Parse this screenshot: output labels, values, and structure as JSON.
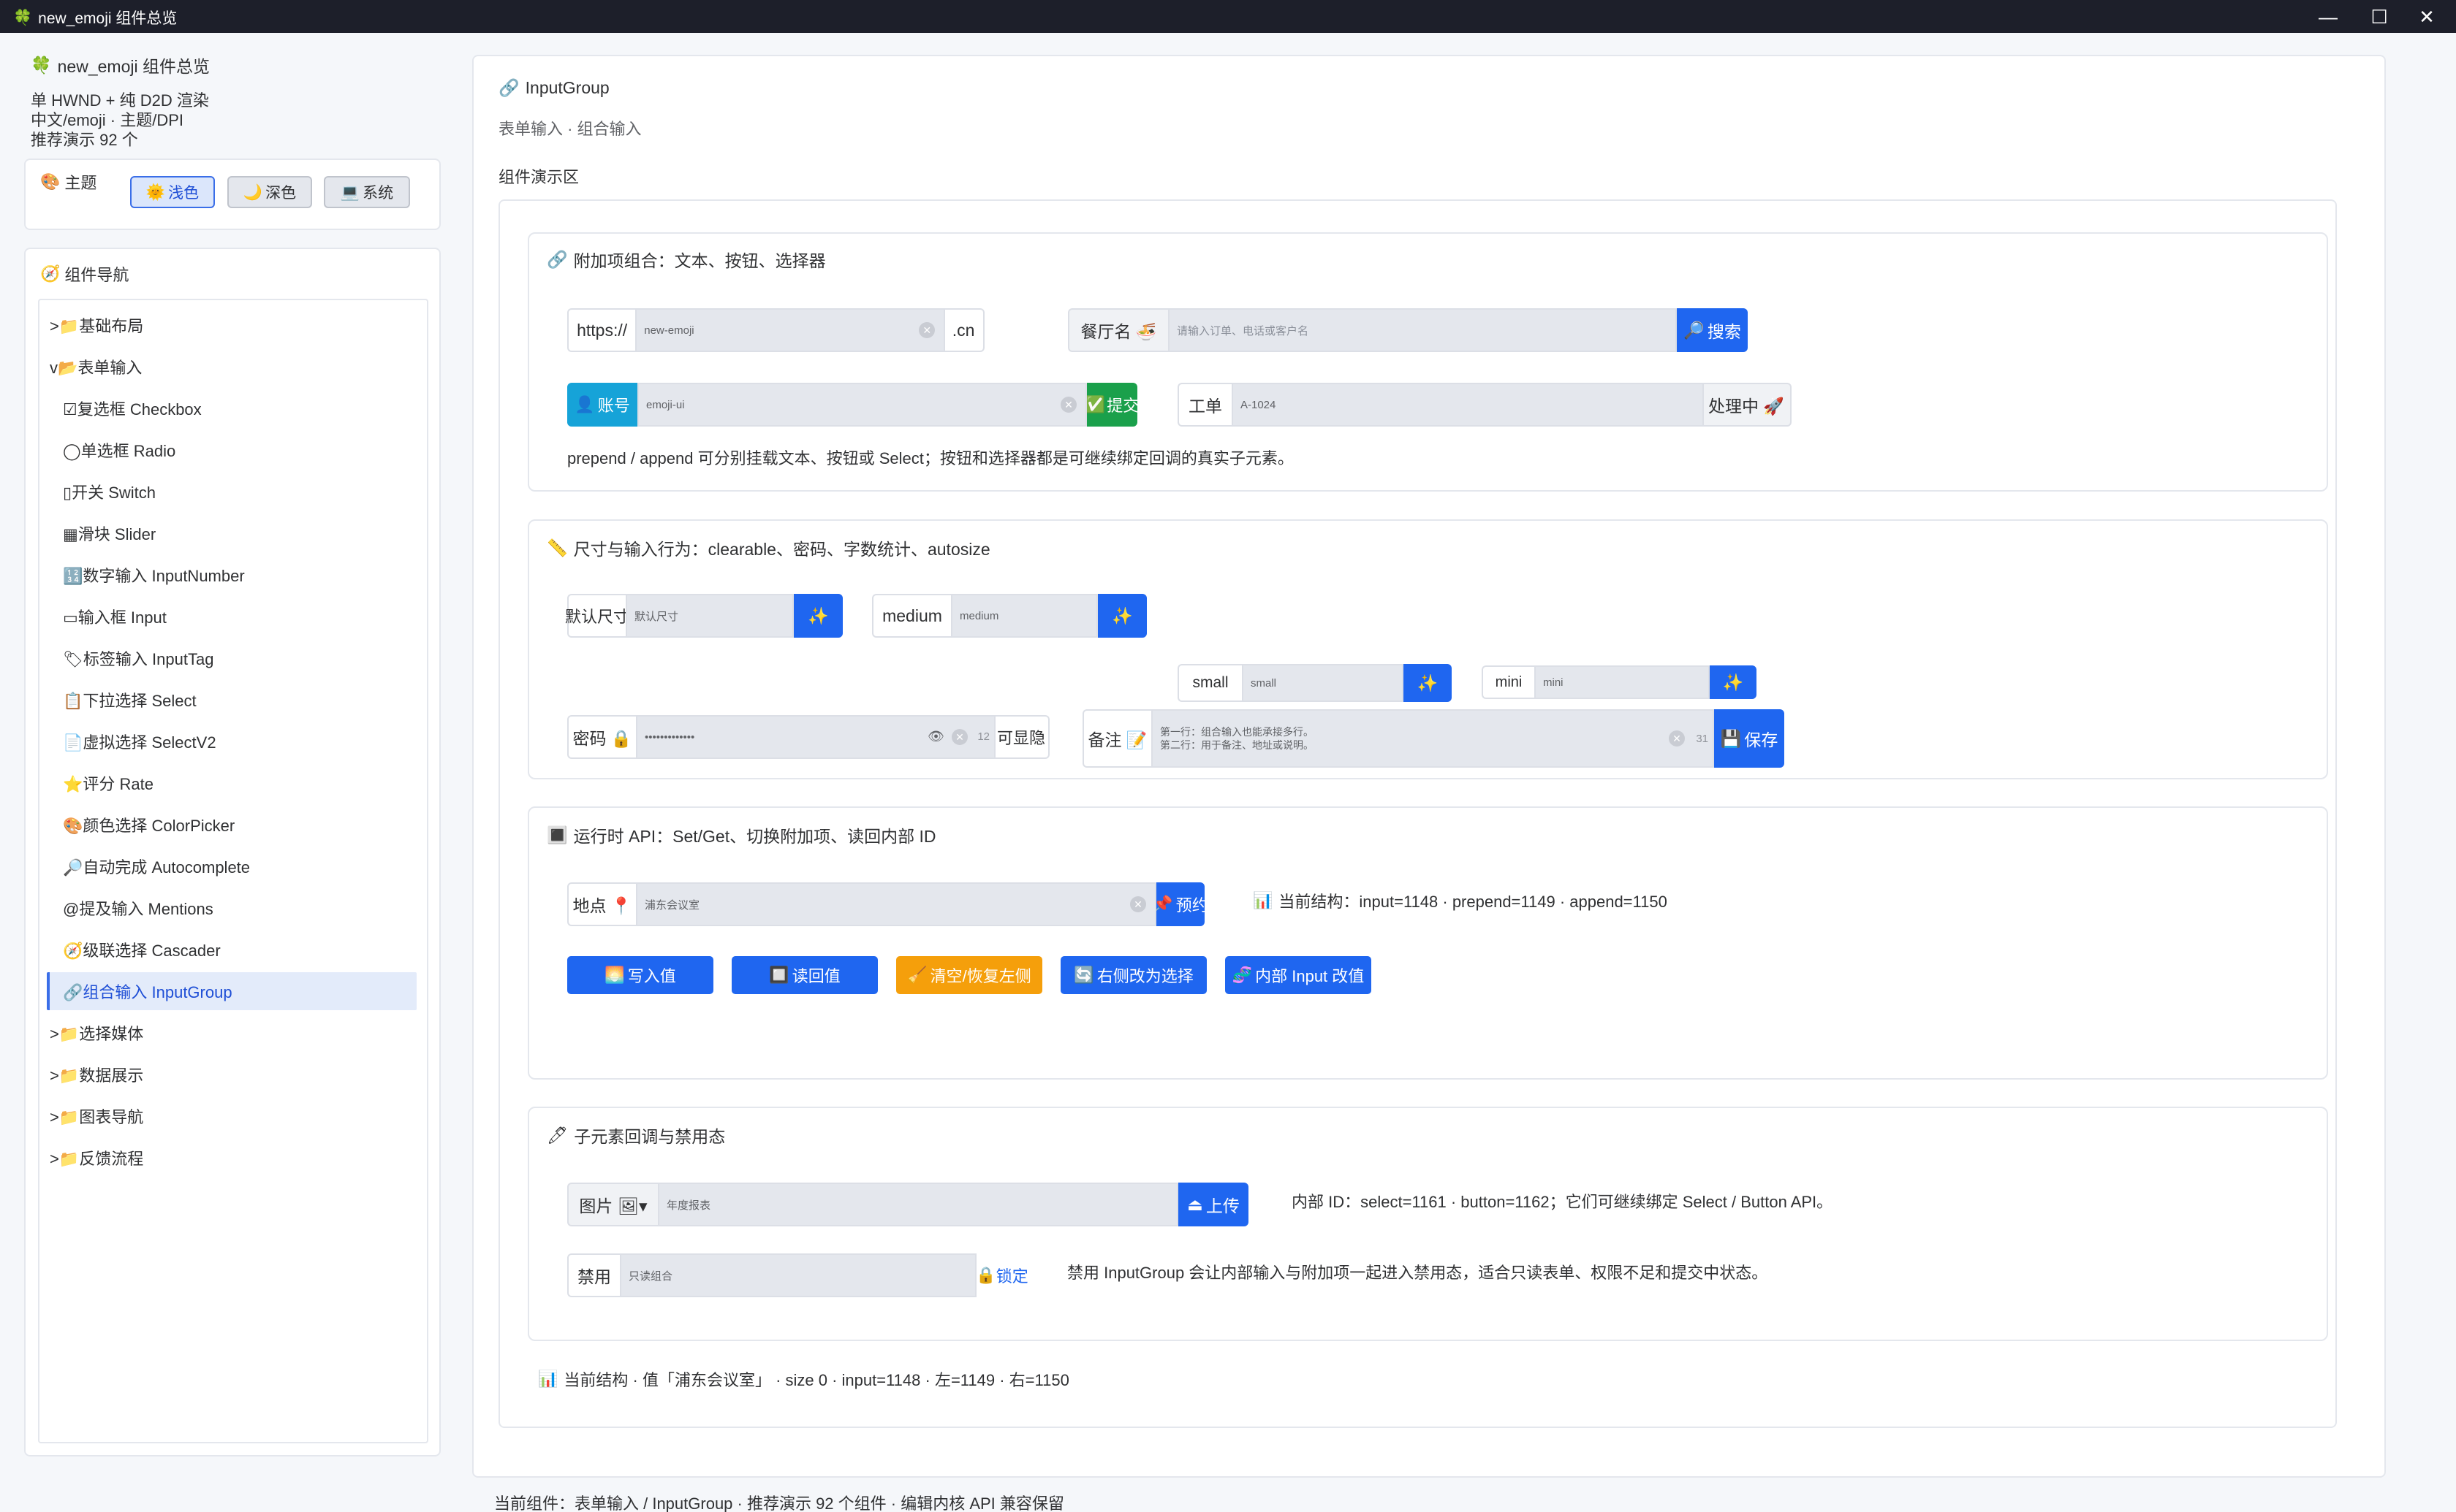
{
  "window": {
    "title": "new_emoji 组件总览",
    "minimize": "—",
    "maximize": "☐",
    "close": "✕"
  },
  "sidebar": {
    "app_title": "new_emoji 组件总览",
    "desc": [
      "单 HWND + 纯 D2D 渲染",
      "中文/emoji · 主题/DPI",
      "推荐演示 92 个"
    ],
    "theme": {
      "label": "主题",
      "buttons": [
        {
          "label": "浅色",
          "icon": "🌞"
        },
        {
          "label": "深色",
          "icon": "🌙"
        },
        {
          "label": "系统",
          "icon": "💻"
        }
      ],
      "active": "浅色"
    },
    "nav_title": "组件导航",
    "nav": [
      {
        "label": ">📁基础布局"
      },
      {
        "label": "v📂表单输入"
      },
      {
        "label": "☑复选框 Checkbox"
      },
      {
        "label": "◯单选框 Radio"
      },
      {
        "label": "▯开关 Switch"
      },
      {
        "label": "▦滑块 Slider"
      },
      {
        "label": "🔢数字输入 InputNumber"
      },
      {
        "label": "▭输入框 Input"
      },
      {
        "label": "🏷标签输入 InputTag"
      },
      {
        "label": "📋下拉选择 Select"
      },
      {
        "label": "📄虚拟选择 SelectV2"
      },
      {
        "label": "⭐评分 Rate"
      },
      {
        "label": "🎨颜色选择 ColorPicker"
      },
      {
        "label": "🔎自动完成 Autocomplete"
      },
      {
        "label": "@提及输入 Mentions"
      },
      {
        "label": "🧭级联选择 Cascader"
      },
      {
        "label": "🔗组合输入 InputGroup"
      },
      {
        "label": ">📁选择媒体"
      },
      {
        "label": ">📁数据展示"
      },
      {
        "label": ">📁图表导航"
      },
      {
        "label": ">📁反馈流程"
      }
    ],
    "selected": "🔗组合输入 InputGroup"
  },
  "main": {
    "title": "InputGroup",
    "subtitle": "表单输入 · 组合输入",
    "demo_label": "组件演示区",
    "s1": {
      "title": "附加项组合：文本、按钮、选择器",
      "g1": {
        "prepend": "https://",
        "value": "new-emoji",
        "append": ".cn"
      },
      "g2": {
        "prepend": "餐厅名 🍜",
        "placeholder": "请输入订单、电话或客户名",
        "button": "搜索"
      },
      "g3": {
        "prepend": "账号",
        "value": "emoji-ui",
        "button": "提交"
      },
      "g4": {
        "prepend": "工单",
        "value": "A-1024",
        "append": "处理中 🚀"
      },
      "note": "prepend / append 可分别挂载文本、按钮或 Select；按钮和选择器都是可继续绑定回调的真实子元素。"
    },
    "s2": {
      "title": "尺寸与输入行为：clearable、密码、字数统计、autosize",
      "default": {
        "prepend": "默认尺寸",
        "value": "默认尺寸"
      },
      "medium": {
        "prepend": "medium",
        "value": "medium"
      },
      "small": {
        "prepend": "small",
        "value": "small"
      },
      "mini": {
        "prepend": "mini",
        "value": "mini"
      },
      "password": {
        "prepend": "密码 🔒",
        "value": "•••••••••••••",
        "count": "12",
        "append": "可显隐"
      },
      "remark": {
        "prepend": "备注 📝",
        "line1": "第一行：组合输入也能承接多行。",
        "line2": "第二行：用于备注、地址或说明。",
        "count": "31",
        "button": "保存"
      }
    },
    "s3": {
      "title": "运行时 API：Set/Get、切换附加项、读回内部 ID",
      "group": {
        "prepend": "地点 📍",
        "value": "浦东会议室",
        "button": "预约"
      },
      "status": "当前结构：input=1148 · prepend=1149 · append=1150",
      "actions": [
        {
          "icon": "🌅",
          "label": "写入值"
        },
        {
          "icon": "🔲",
          "label": "读回值"
        },
        {
          "icon": "🧹",
          "label": "清空/恢复左侧"
        },
        {
          "icon": "🔄",
          "label": "右侧改为选择"
        },
        {
          "icon": "🧬",
          "label": "内部 Input 改值"
        }
      ]
    },
    "s4": {
      "title": "子元素回调与禁用态",
      "image": {
        "prepend": "图片 🖼▾",
        "value": "年度报表",
        "button": "上传"
      },
      "image_note": "内部 ID：select=1161 · button=1162；它们可继续绑定 Select / Button API。",
      "disabled": {
        "prepend": "禁用",
        "value": "只读组合",
        "append": "锁定"
      },
      "disabled_note": "禁用 InputGroup 会让内部输入与附加项一起进入禁用态，适合只读表单、权限不足和提交中状态。"
    },
    "footer_status": "当前结构 · 值「浦东会议室」 · size 0 · input=1148 · 左=1149 · 右=1150"
  },
  "statusbar": "当前组件：表单输入 / InputGroup · 推荐演示 92 个组件 · 编辑内核 API 兼容保留",
  "colors": {
    "accent": "#1f66f0",
    "green": "#1aa04b",
    "cyan": "#16a3d8",
    "orange": "#f59f0b",
    "titlebar": "#1d1f2a"
  }
}
